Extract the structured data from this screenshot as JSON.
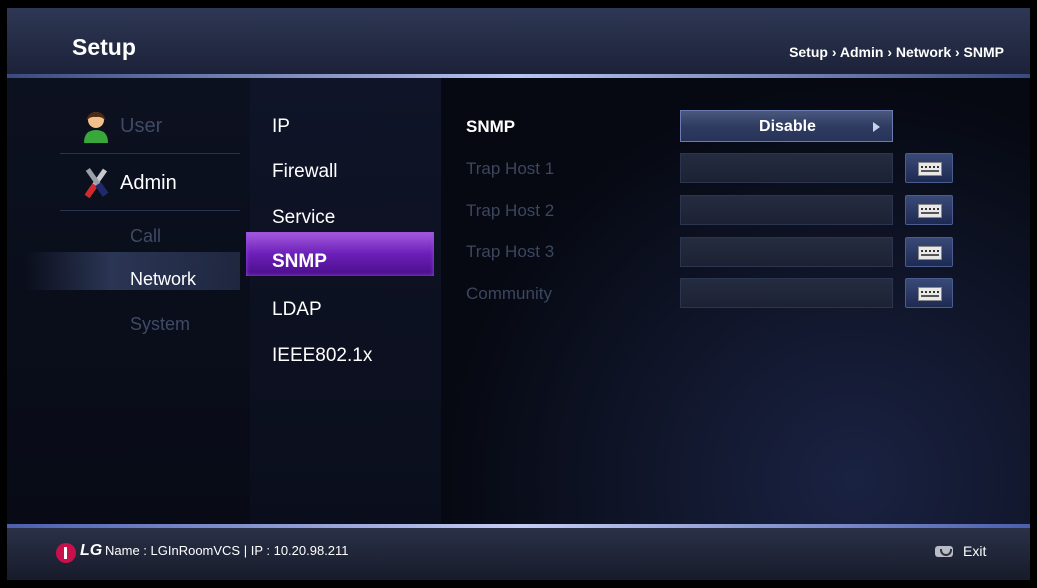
{
  "header": {
    "title": "Setup",
    "breadcrumb": "Setup › Admin › Network › SNMP"
  },
  "categories": {
    "user": "User",
    "admin": "Admin",
    "call": "Call",
    "network": "Network",
    "system": "System"
  },
  "network_menu": {
    "items": [
      "IP",
      "Firewall",
      "Service",
      "SNMP",
      "LDAP",
      "IEEE802.1x"
    ],
    "selected": "SNMP"
  },
  "settings": {
    "snmp_label": "SNMP",
    "snmp_value": "Disable",
    "trap_host_1_label": "Trap Host 1",
    "trap_host_1_value": "",
    "trap_host_2_label": "Trap Host 2",
    "trap_host_2_value": "",
    "trap_host_3_label": "Trap Host 3",
    "trap_host_3_value": "",
    "community_label": "Community",
    "community_value": ""
  },
  "footer": {
    "brand": "LG",
    "info": "Name : LGInRoomVCS  |  IP : 10.20.98.211",
    "exit_label": "Exit"
  },
  "icons": {
    "user": "user-icon",
    "admin": "tools-icon",
    "keyboard": "keyboard-icon",
    "dropdown": "arrow-right-icon",
    "exit": "phone-hangup-icon"
  },
  "colors": {
    "selected_purple": "#7a2cc8",
    "background": "#080c18",
    "accent_line": "#b8c4f0"
  }
}
